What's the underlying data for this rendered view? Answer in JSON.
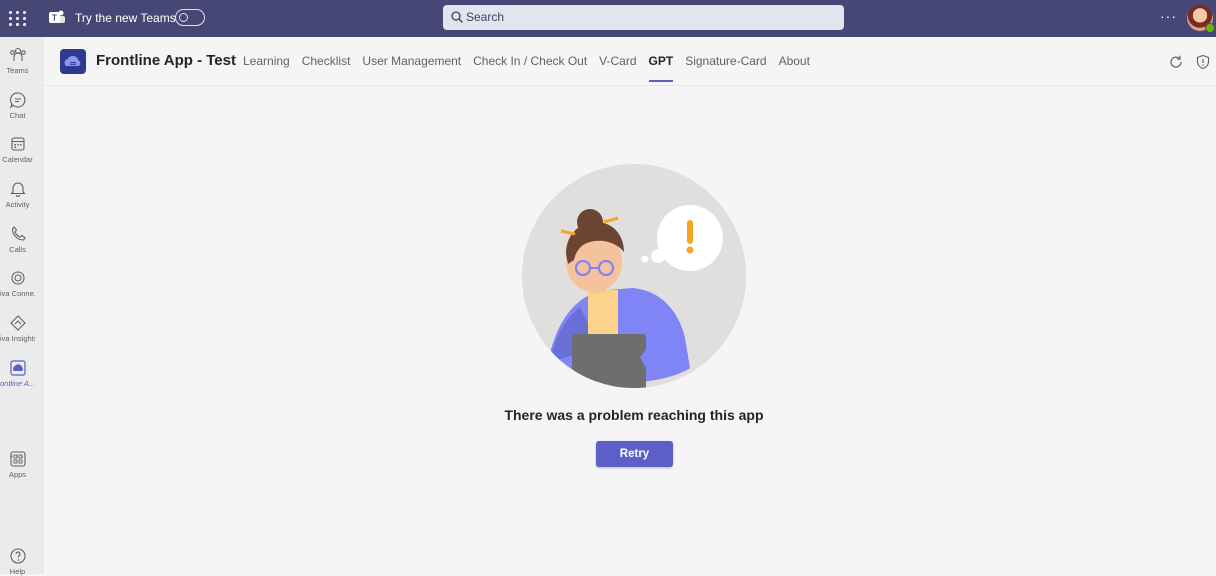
{
  "topbar": {
    "try_new_teams": "Try the new Teams",
    "search_placeholder": "Search",
    "more_label": "···"
  },
  "rail": {
    "items": [
      {
        "label": "Teams",
        "icon": "teams-icon"
      },
      {
        "label": "Chat",
        "icon": "chat-icon"
      },
      {
        "label": "Calendar",
        "icon": "calendar-icon"
      },
      {
        "label": "Activity",
        "icon": "bell-icon"
      },
      {
        "label": "Calls",
        "icon": "phone-icon"
      },
      {
        "label": "iva Conne...",
        "icon": "viva-connections-icon"
      },
      {
        "label": "iva Insights",
        "icon": "viva-insights-icon"
      },
      {
        "label": "ontline A...",
        "icon": "frontline-app-icon",
        "active": true
      },
      {
        "label": "Apps",
        "icon": "apps-icon"
      },
      {
        "label": "Help",
        "icon": "help-icon"
      }
    ],
    "more": "···"
  },
  "app": {
    "title": "Frontline App - Test",
    "tabs": [
      "Learning",
      "Checklist",
      "User Management",
      "Check In / Check Out",
      "V-Card",
      "GPT",
      "Signature-Card",
      "About"
    ],
    "active_tab": "GPT"
  },
  "main": {
    "error_message": "There was a problem reaching this app",
    "retry_label": "Retry"
  },
  "colors": {
    "topbar": "#464775",
    "accent": "#5b5fc7",
    "rail": "#ebebeb",
    "background": "#f5f5f5"
  }
}
